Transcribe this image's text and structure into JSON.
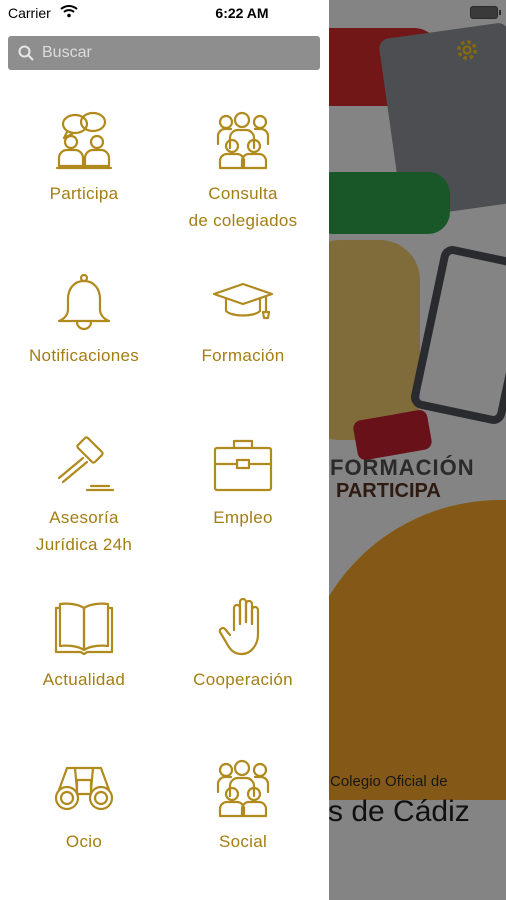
{
  "status_bar": {
    "carrier": "Carrier",
    "time": "6:22 AM"
  },
  "search": {
    "placeholder": "Buscar"
  },
  "menu": {
    "items": [
      {
        "label": "Participa",
        "icon": "people-talking-icon"
      },
      {
        "label": "Consulta\nde colegiados",
        "icon": "group-icon"
      },
      {
        "label": "Notificaciones",
        "icon": "bell-icon"
      },
      {
        "label": "Formación",
        "icon": "graduation-cap-icon"
      },
      {
        "label": "Asesoría\nJurídica 24h",
        "icon": "gavel-icon"
      },
      {
        "label": "Empleo",
        "icon": "briefcase-icon"
      },
      {
        "label": "Actualidad",
        "icon": "open-book-icon"
      },
      {
        "label": "Cooperación",
        "icon": "hand-icon"
      },
      {
        "label": "Ocio",
        "icon": "binoculars-icon"
      },
      {
        "label": "Social",
        "icon": "group-icon"
      }
    ]
  },
  "background": {
    "banner_line1": "FORMACIÓN",
    "banner_line2": "PARTICIPA",
    "college_line1": "Colegio Oficial de",
    "college_line2": "s de Cádiz"
  },
  "colors": {
    "accent": "#a37e13",
    "search_bg": "#8e8e8e"
  }
}
